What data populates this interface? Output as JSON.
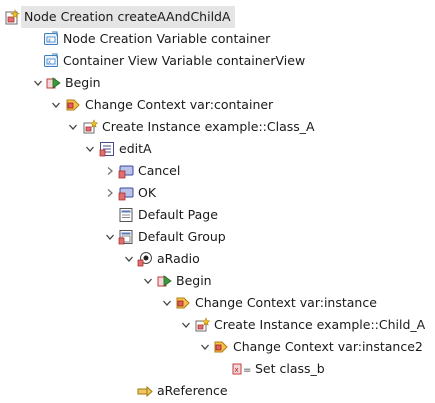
{
  "tree": [
    {
      "text": "Node Creation createAAndChildA",
      "icon": "node-creation-icon",
      "twisty": "expanded"
    },
    {
      "text": "Node Creation Variable container",
      "icon": "variable-icon",
      "twisty": "none"
    },
    {
      "text": "Container View Variable containerView",
      "icon": "variable-icon",
      "twisty": "none"
    },
    {
      "text": "Begin",
      "icon": "begin-icon",
      "twisty": "expanded"
    },
    {
      "text": "Change Context var:container",
      "icon": "change-context-icon",
      "twisty": "expanded"
    },
    {
      "text": "Create Instance example::Class_A",
      "icon": "create-instance-icon",
      "twisty": "expanded"
    },
    {
      "text": "editA",
      "icon": "list-icon",
      "twisty": "expanded"
    },
    {
      "text": "Cancel",
      "icon": "button-icon",
      "twisty": "collapsed"
    },
    {
      "text": "OK",
      "icon": "button-icon",
      "twisty": "collapsed"
    },
    {
      "text": "Default Page",
      "icon": "page-icon",
      "twisty": "none"
    },
    {
      "text": "Default Group",
      "icon": "group-icon",
      "twisty": "expanded"
    },
    {
      "text": "aRadio",
      "icon": "radio-icon",
      "twisty": "expanded"
    },
    {
      "text": "Begin",
      "icon": "begin-icon",
      "twisty": "expanded"
    },
    {
      "text": "Change Context var:instance",
      "icon": "change-context-icon",
      "twisty": "expanded"
    },
    {
      "text": "Create Instance example::Child_A",
      "icon": "create-instance-icon",
      "twisty": "expanded"
    },
    {
      "text": "Change Context var:instance2",
      "icon": "change-context-icon",
      "twisty": "expanded"
    },
    {
      "text": "Set class_b",
      "icon": "set-icon",
      "twisty": "none"
    },
    {
      "text": "aReference",
      "icon": "reference-icon",
      "twisty": "none"
    }
  ]
}
